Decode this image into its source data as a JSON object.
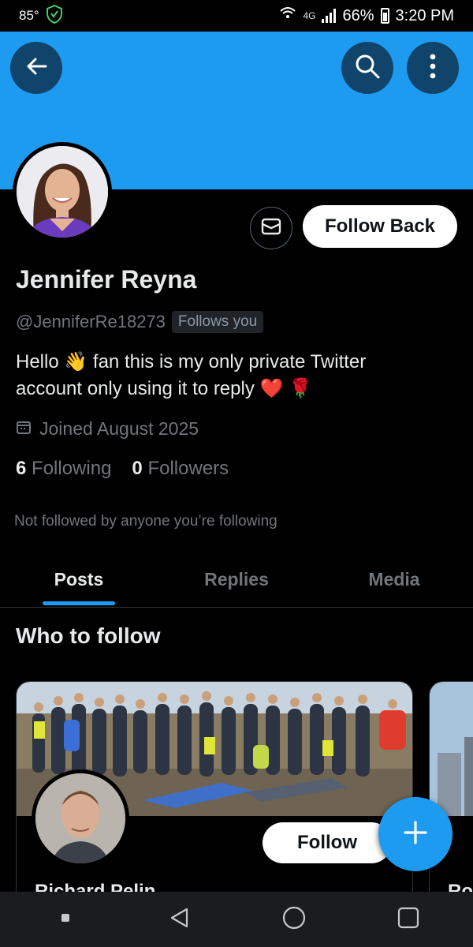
{
  "status_bar": {
    "temperature": "85°",
    "network": "4G",
    "battery": "66%",
    "time": "3:20 PM"
  },
  "header": {
    "back_icon": "arrow-left-icon",
    "search_icon": "search-icon",
    "more_icon": "more-vertical-icon",
    "banner_color": "#1d9bf0"
  },
  "profile": {
    "name": "Jennifer Reyna",
    "handle": "@JenniferRe18273",
    "follows_you_badge": "Follows you",
    "bio_line1": "Hello 👋 fan this is my only private Twitter",
    "bio_line2": "account only using it to reply ❤️ 🌹",
    "joined": "Joined August 2025",
    "following_count": "6",
    "following_label": "Following",
    "followers_count": "0",
    "followers_label": "Followers",
    "not_followed_note": "Not followed by anyone you’re following",
    "message_button_icon": "envelope-icon",
    "follow_back_label": "Follow Back"
  },
  "tabs": [
    {
      "label": "Posts",
      "active": true
    },
    {
      "label": "Replies",
      "active": false
    },
    {
      "label": "Media",
      "active": false
    }
  ],
  "who_to_follow": {
    "title": "Who to follow",
    "cards": [
      {
        "name": "Richard Pelin",
        "follow_label": "Follow"
      },
      {
        "name": "Ro"
      }
    ]
  },
  "fab_icon": "plus-icon",
  "accent_color": "#1d9bf0",
  "nav_bar": {
    "recents_icon": "square-small-icon",
    "back_icon": "triangle-back-icon",
    "home_icon": "circle-home-icon",
    "overview_icon": "square-overview-icon"
  }
}
